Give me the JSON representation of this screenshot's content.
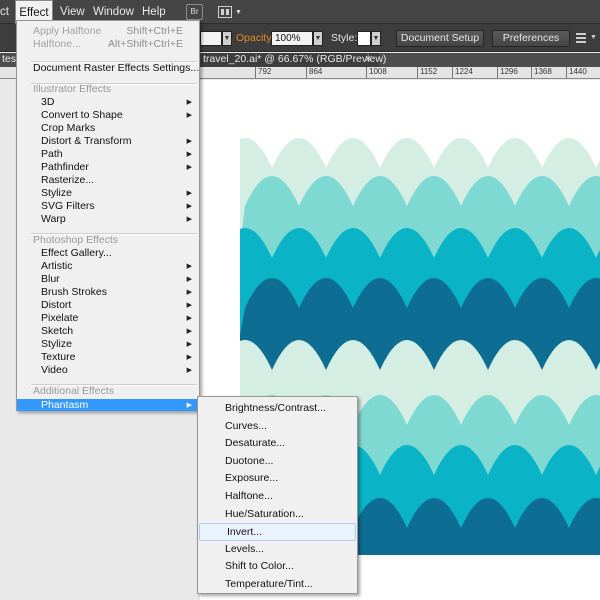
{
  "menubar": {
    "items": [
      "ct",
      "Effect",
      "View",
      "Window",
      "Help"
    ],
    "bridge_icon": "Br",
    "workspace_icon": "arrange-documents-icon"
  },
  "controlbar": {
    "left_stub": "",
    "opacity_label": "Opacity:",
    "opacity_value": "100%",
    "style_label": "Style:",
    "document_setup": "Document Setup",
    "preferences": "Preferences",
    "colors": {
      "opacity_label": "#e08a2a",
      "style_label": "#e6e6e6"
    }
  },
  "tabs": {
    "left_stub": "tes",
    "active_tab": "travel_20.ai* @ 66.67% (RGB/Preview)",
    "close": "×"
  },
  "ruler": {
    "ticks": [
      "792",
      "864",
      "1008",
      "1152",
      "1224",
      "1296",
      "1368",
      "1440"
    ]
  },
  "effect_menu": {
    "items": [
      {
        "label": "Apply Halftone",
        "shortcut": "Shift+Ctrl+E",
        "disabled": true
      },
      {
        "label": "Halftone...",
        "shortcut": "Alt+Shift+Ctrl+E",
        "disabled": true
      },
      {
        "label": "Document Raster Effects Settings..."
      },
      {
        "label": "Illustrator Effects",
        "header": true
      },
      {
        "label": "3D",
        "submenu": true
      },
      {
        "label": "Convert to Shape",
        "submenu": true
      },
      {
        "label": "Crop Marks"
      },
      {
        "label": "Distort & Transform",
        "submenu": true
      },
      {
        "label": "Path",
        "submenu": true
      },
      {
        "label": "Pathfinder",
        "submenu": true
      },
      {
        "label": "Rasterize..."
      },
      {
        "label": "Stylize",
        "submenu": true
      },
      {
        "label": "SVG Filters",
        "submenu": true
      },
      {
        "label": "Warp",
        "submenu": true
      },
      {
        "label": "Photoshop Effects",
        "header": true
      },
      {
        "label": "Effect Gallery..."
      },
      {
        "label": "Artistic",
        "submenu": true
      },
      {
        "label": "Blur",
        "submenu": true
      },
      {
        "label": "Brush Strokes",
        "submenu": true
      },
      {
        "label": "Distort",
        "submenu": true
      },
      {
        "label": "Pixelate",
        "submenu": true
      },
      {
        "label": "Sketch",
        "submenu": true
      },
      {
        "label": "Stylize",
        "submenu": true
      },
      {
        "label": "Texture",
        "submenu": true
      },
      {
        "label": "Video",
        "submenu": true
      },
      {
        "label": "Additional Effects",
        "header": true
      },
      {
        "label": "Phantasm",
        "submenu": true,
        "highlighted": true
      }
    ]
  },
  "phantasm_menu": {
    "items": [
      "Brightness/Contrast...",
      "Curves...",
      "Desaturate...",
      "Duotone...",
      "Exposure...",
      "Halftone...",
      "Hue/Saturation...",
      "Invert...",
      "Levels...",
      "Shift to Color...",
      "Temperature/Tint..."
    ],
    "hovered": "Invert..."
  },
  "artwork": {
    "wave_colors": [
      "#d4eee3",
      "#7ed9d2",
      "#0ab3c5",
      "#0d6d93",
      "#d4eee3",
      "#7ed9d2",
      "#0ab3c5",
      "#0d6d93"
    ]
  }
}
